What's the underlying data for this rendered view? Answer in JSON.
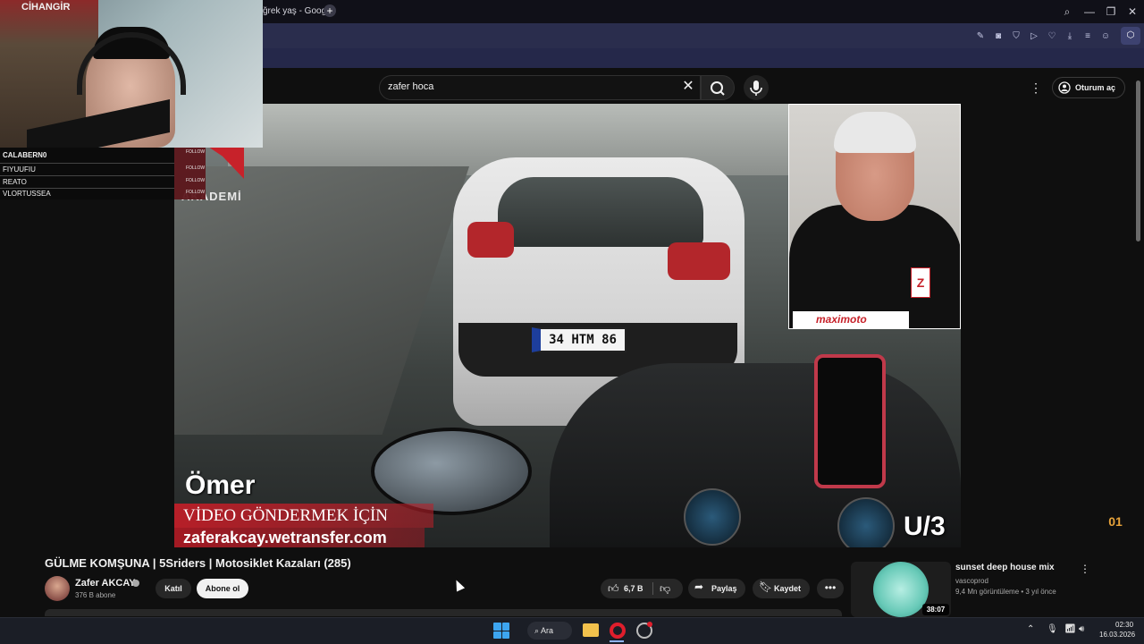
{
  "browser": {
    "tab_title": "ğrek yaş - Googl",
    "new_tab_symbol": "+",
    "window_buttons": [
      "⌕",
      "—",
      "❐",
      "✕"
    ]
  },
  "youtube": {
    "search": {
      "query": "zafer hoca",
      "clear_symbol": "✕"
    },
    "menu_symbol": "⋮",
    "signin_label": "Oturum aç"
  },
  "video": {
    "academy_label": "AKADEMİ",
    "name_overlay": "Ömer",
    "banner_line1": "VİDEO GÖNDERMEK İÇİN",
    "banner_line2": "zaferakcay.wetransfer.com",
    "part_label": "U/3",
    "plate": "34 HTM 86",
    "inset_brand": "maximoto"
  },
  "stream_overlay": {
    "cam_sign": "CİHANGİR",
    "chat": [
      {
        "name": "CALABERN0",
        "follow": "FOLLOW"
      },
      {
        "name": "FIYUUFIU",
        "follow": "FOLLOW"
      },
      {
        "name": "REATO",
        "follow": "FOLLOW"
      },
      {
        "name": "VLORTUSSEA",
        "follow": "FOLLOW"
      }
    ]
  },
  "watch": {
    "title": "GÜLME KOMŞUNA | 5Sriders | Motosiklet Kazaları (285)",
    "channel_name": "Zafer AKCAY",
    "subscribers": "376 B abone",
    "join_label": "Katıl",
    "subscribe_label": "Abone ol",
    "like_count": "6,7 B",
    "share_label": "Paylaş",
    "save_label": "Kaydet",
    "more_symbol": "•••"
  },
  "related": {
    "title": "sunset deep house mix",
    "channel": "vascoprod",
    "meta": "9,4 Mn görüntüleme • 3 yıl önce",
    "duration": "38:07",
    "more_symbol": "⋮"
  },
  "watermark_text": "01",
  "taskbar": {
    "search_label": "Ara",
    "time": "02:30",
    "date": "16.03.2026"
  },
  "colors": {
    "youtube_bg": "#0f0f0f",
    "browser_toolbar": "#2a2d4d",
    "accent_red": "#c7222a",
    "taskbar": "#1b1e26"
  },
  "icons": [
    "search-icon",
    "mic-icon",
    "user-circle-icon",
    "like-icon",
    "dislike-icon",
    "share-icon",
    "bookmark-icon",
    "windows-start-icon",
    "folder-icon",
    "opera-icon",
    "wifi-icon",
    "volume-icon"
  ]
}
